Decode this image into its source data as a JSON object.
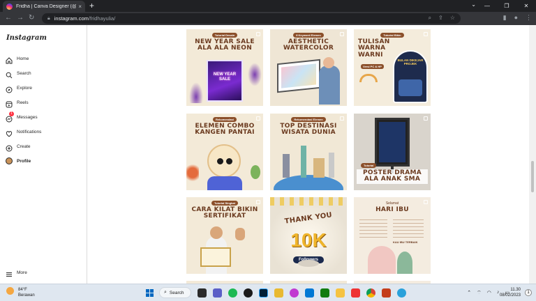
{
  "browser": {
    "tab_title": "Fridha | Canva Designer (@fridha",
    "tab_close": "×",
    "new_tab": "+",
    "url_host": "instagram.com",
    "url_path": "/fridhayulia/",
    "win_minimize": "—",
    "win_restore": "❐",
    "win_close": "✕"
  },
  "sidebar": {
    "logo": "Instagram",
    "items": [
      {
        "label": "Home",
        "icon": "home-icon"
      },
      {
        "label": "Search",
        "icon": "search-icon"
      },
      {
        "label": "Explore",
        "icon": "compass-icon"
      },
      {
        "label": "Reels",
        "icon": "reels-icon"
      },
      {
        "label": "Messages",
        "icon": "messenger-icon",
        "badge": "1"
      },
      {
        "label": "Notifications",
        "icon": "heart-icon"
      },
      {
        "label": "Create",
        "icon": "plus-square-icon"
      },
      {
        "label": "Profile",
        "icon": "avatar"
      }
    ],
    "more": "More"
  },
  "posts": [
    {
      "kicker": "Tutorial Desain",
      "headline": "NEW YEAR SALE ALA ALA NEON",
      "inner": "NEW YEAR SALE"
    },
    {
      "kicker": "8 Keyword Elemen",
      "headline": "AESTHETIC WATERCOLOR"
    },
    {
      "kicker": "Tutorial Bikin",
      "headline": "TULISAN WARNA WARNI",
      "sub": "Versi PC & HP",
      "inner": "BULAN DIKEJAR PROJEK"
    },
    {
      "kicker": "Rekomendasi",
      "headline": "ELEMEN COMBO KANGEN PANTAI"
    },
    {
      "kicker": "Rekomendasi Elemen",
      "headline": "TOP DESTINASI WISATA DUNIA"
    },
    {
      "kicker": "Tutorial",
      "headline": "POSTER DRAMA ALA ANAK SMA"
    },
    {
      "kicker": "Tutorial Singkat",
      "headline": "CARA KILAT BIKIN SERTIFIKAT"
    },
    {
      "headline": "THANK YOU",
      "big": "10K",
      "sub": "Followers"
    },
    {
      "kicker": "Selamat",
      "headline": "HARI IBU",
      "sub": "KAU IBU TERBAIK"
    }
  ],
  "taskbar": {
    "temperature": "84°F",
    "condition": "Berawan",
    "search": "Search",
    "time": "11.30",
    "date": "08/02/2023",
    "notification_count": "1"
  },
  "colors": {
    "chrome_dark": "#202124",
    "chrome_toolbar": "#35363a",
    "post_cream": "#f3ead8",
    "post_brown": "#6b3a1f",
    "taskbar": "#dfe7f0"
  }
}
